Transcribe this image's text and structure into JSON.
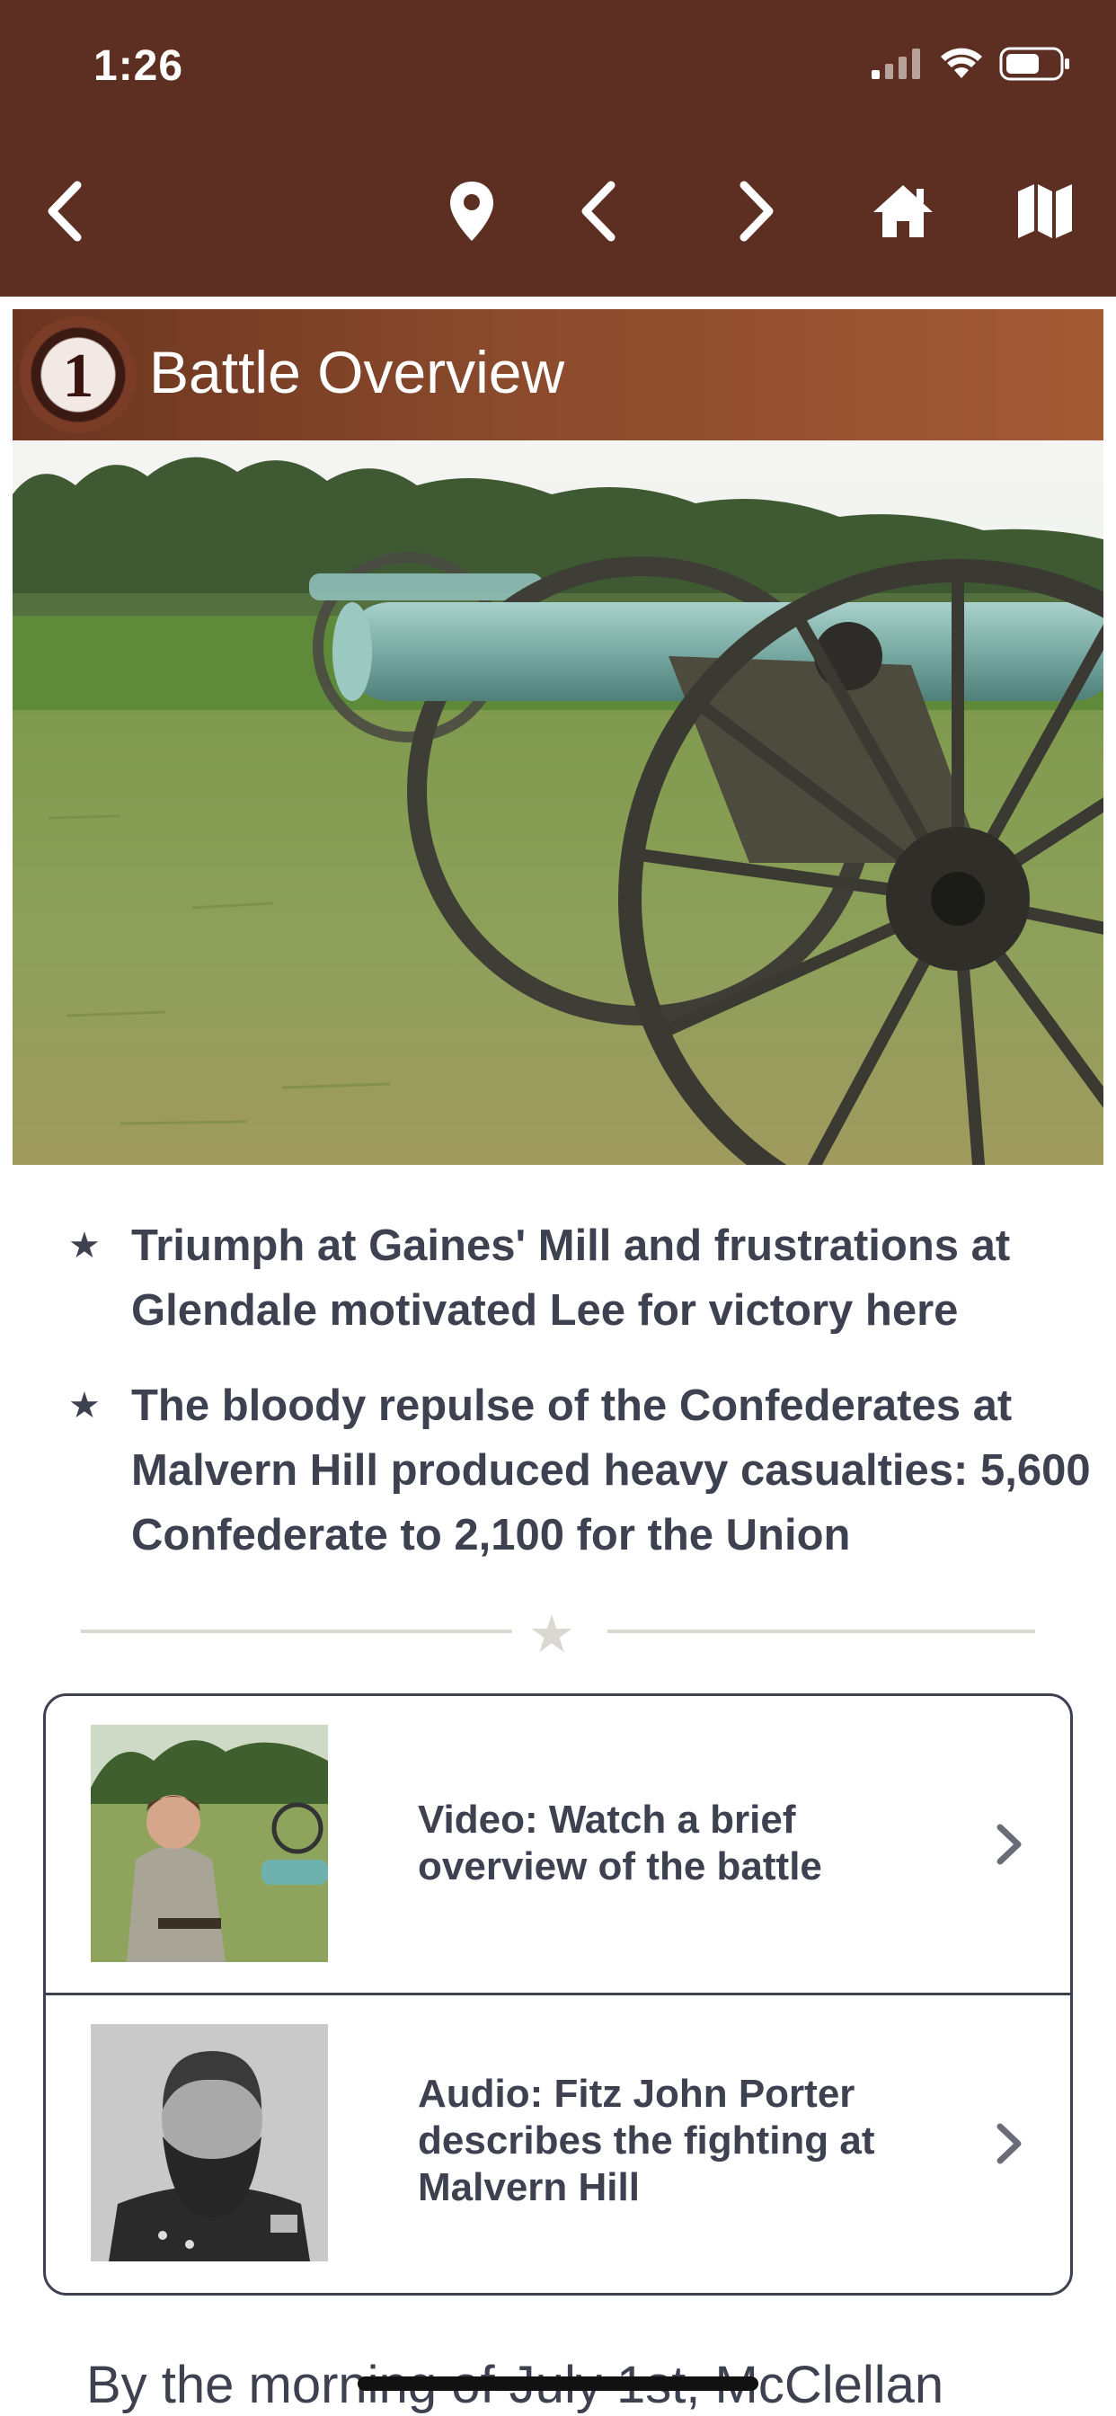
{
  "status_bar": {
    "time": "1:26"
  },
  "nav_bar": {
    "icons": [
      "back-chevron-icon",
      "location-pin-icon",
      "previous-chevron-icon",
      "next-chevron-icon",
      "home-icon",
      "map-icon"
    ]
  },
  "section": {
    "number": "1",
    "title": "Battle Overview"
  },
  "bullets": [
    {
      "text": "Triumph at Gaines' Mill and frustrations at Glendale motivated Lee for victory here"
    },
    {
      "text": "The bloody repulse of the Confederates at Malvern Hill produced heavy casualties: 5,600 Confederate to 2,100 for the Union"
    }
  ],
  "media": [
    {
      "label": "Video: Watch a brief overview of the battle"
    },
    {
      "label": "Audio: Fitz John Porter describes the fighting at Malvern Hill"
    }
  ],
  "body": {
    "text": "By the morning of July 1st, McClellan"
  },
  "colors": {
    "header_brown": "#5c2f22",
    "section_brown": "#8a4a2c",
    "text": "#3d4150",
    "divider": "#dad8d0"
  }
}
